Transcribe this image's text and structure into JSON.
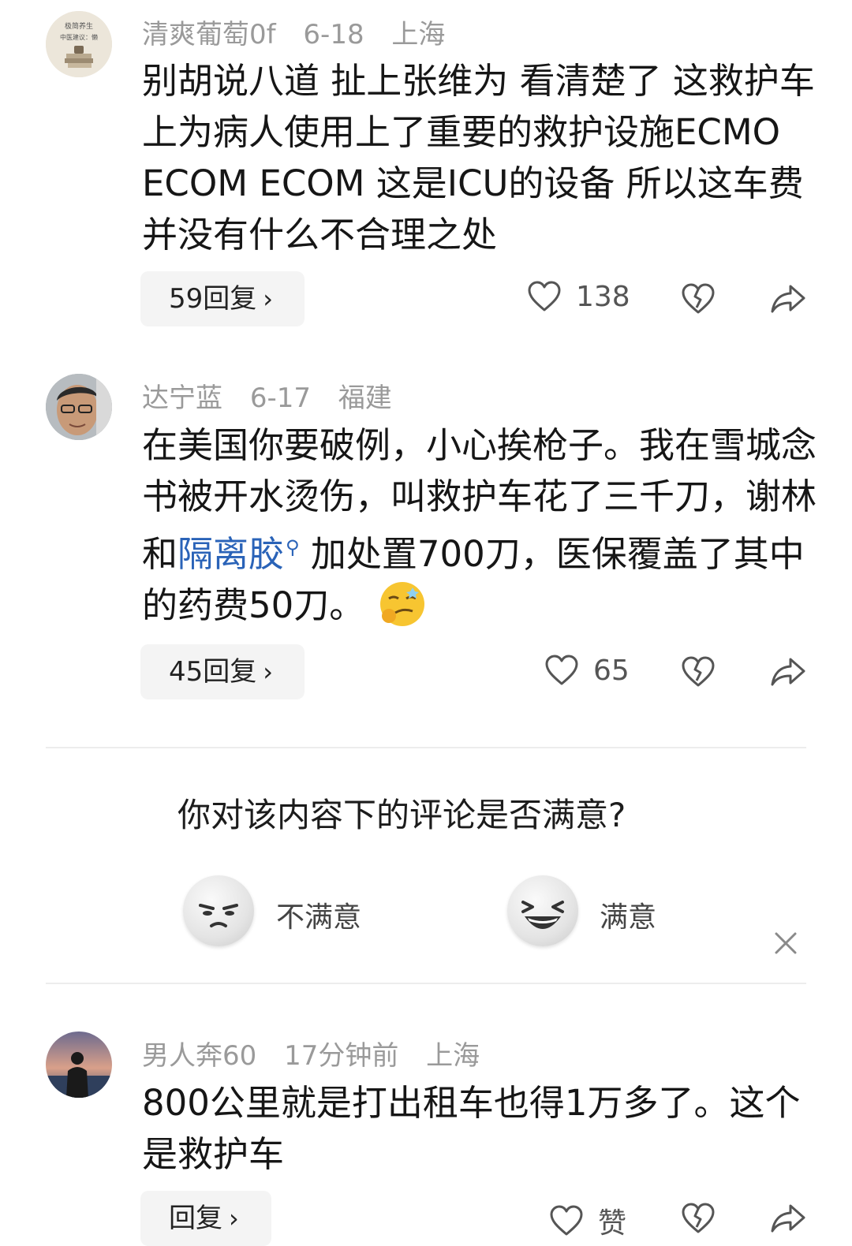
{
  "comments": [
    {
      "user": "清爽葡萄0f",
      "date": "6-18",
      "location": "上海",
      "text": "别胡说八道 扯上张维为 看清楚了 这救护车上为病人使用上了重要的救护设施ECMO ECOM ECOM 这是ICU的设备 所以这车费 并没有什么不合理之处",
      "replies": "59回复",
      "likes": "138"
    },
    {
      "user": "达宁蓝",
      "date": "6-17",
      "location": "福建",
      "text_before": "在美国你要破例，小心挨枪子。我在雪城念书被开水烫伤，叫救护车花了三千刀，谢林和",
      "text_link": "隔离胶",
      "text_after": " 加处置700刀，医保覆盖了其中的药费50刀。",
      "replies": "45回复",
      "likes": "65"
    },
    {
      "user": "男人奔60",
      "date": "17分钟前",
      "location": "上海",
      "text": "800公里就是打出租车也得1万多了。这个是救护车",
      "replies": "回复",
      "likes": "赞"
    }
  ],
  "survey": {
    "question": "你对该内容下的评论是否满意?",
    "negative": "不满意",
    "positive": "满意"
  },
  "avatar1": {
    "text_line1": "极简养生",
    "text_line2": "中医建议：懒"
  },
  "colors": {
    "meta": "#9a9a9a",
    "link": "#2a63b8",
    "reply_bg": "#f4f4f4"
  }
}
